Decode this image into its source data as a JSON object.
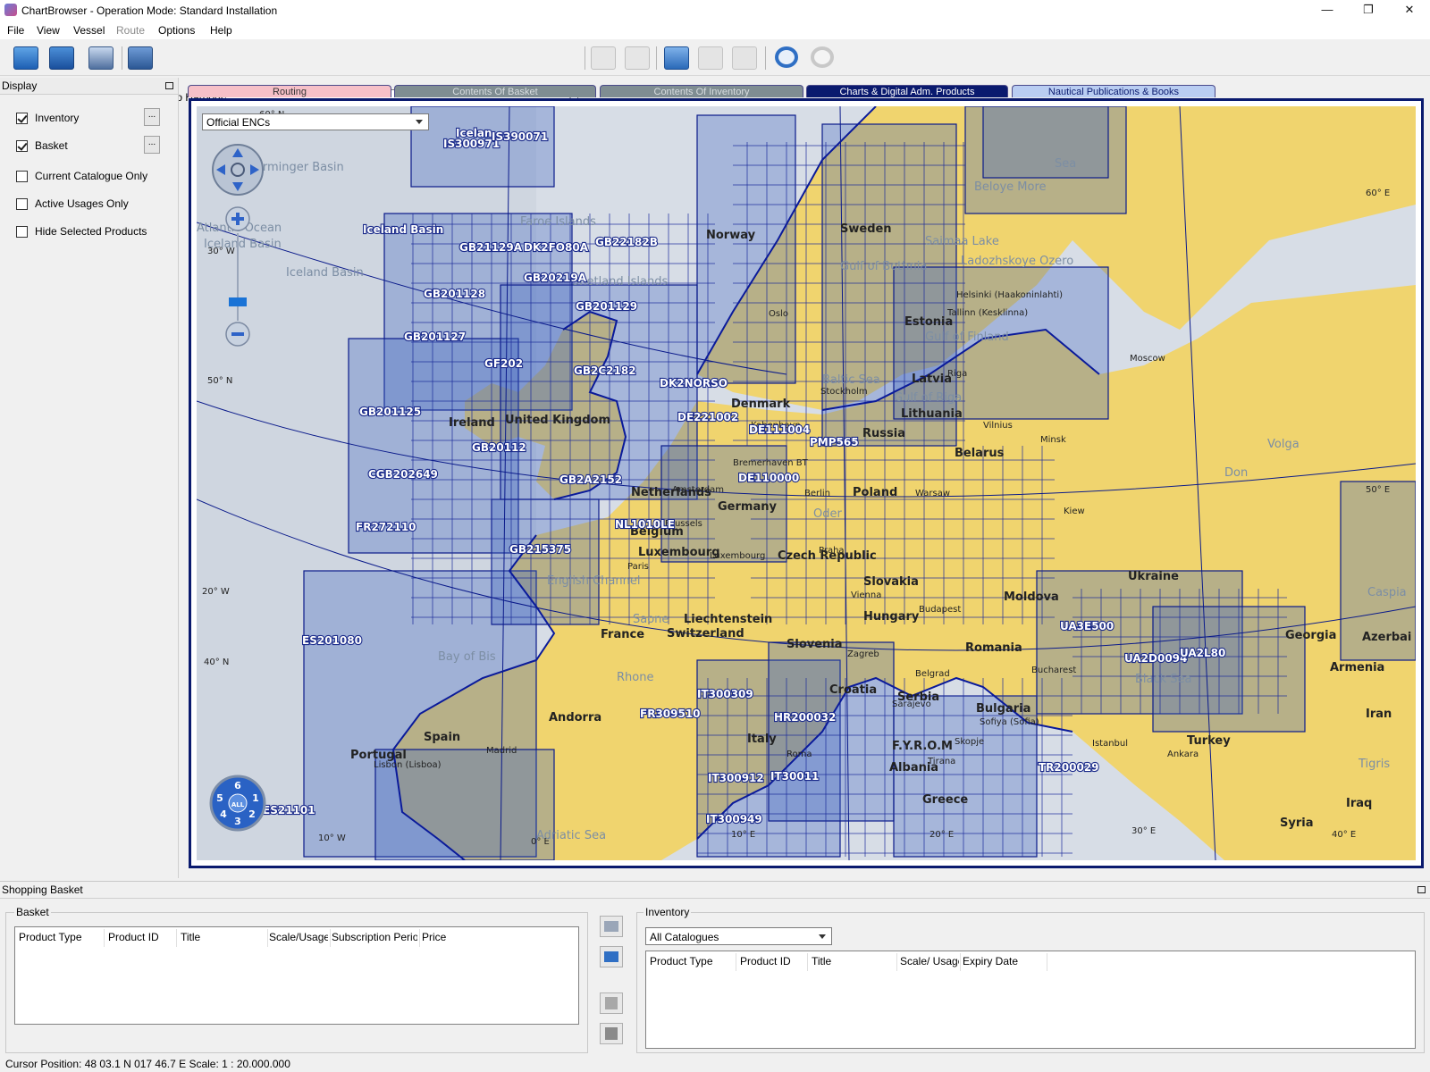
{
  "window": {
    "title": "ChartBrowser - Operation Mode: Standard Installation",
    "controls": {
      "minimize": "—",
      "maximize": "❐",
      "close": "✕"
    }
  },
  "menu": [
    "File",
    "View",
    "Vessel",
    "Route",
    "Options",
    "Help"
  ],
  "toolbar": {
    "goto_label": "Goto Harbour:",
    "goto_value": "",
    "icons": [
      "open-folder-icon",
      "save-icon",
      "vessel-icon",
      "binoculars-icon",
      "zoom-box-icon",
      "zoom-grid-icon",
      "select-pointer-icon",
      "cart-icon",
      "cart-check-icon",
      "undo-icon",
      "redo-icon"
    ]
  },
  "display_panel": {
    "title": "Display",
    "options": [
      {
        "label": "Inventory",
        "checked": true,
        "has_more": true
      },
      {
        "label": "Basket",
        "checked": true,
        "has_more": true
      },
      {
        "label": "Current Catalogue Only",
        "checked": false,
        "has_more": false
      },
      {
        "label": "Active Usages Only",
        "checked": false,
        "has_more": false
      },
      {
        "label": "Hide Selected Products",
        "checked": false,
        "has_more": false
      }
    ],
    "more_label": "..."
  },
  "tabs": [
    {
      "label": "Routing",
      "bg": "#f6c0c8",
      "fg": "#333333"
    },
    {
      "label": "Contents Of Basket",
      "bg": "#7f8d92",
      "fg": "#d8dde0"
    },
    {
      "label": "Contents Of Inventory",
      "bg": "#7f8d92",
      "fg": "#d8dde0"
    },
    {
      "label": "Charts & Digital Adm. Products",
      "bg": "#0a1a6e",
      "fg": "#ffffff",
      "active": true
    },
    {
      "label": "Nautical Publications & Books",
      "bg": "#b9cdf2",
      "fg": "#0a1a6e"
    }
  ],
  "map": {
    "enc_selector": "Official ENCs",
    "colors": {
      "sea": "#d7dde6",
      "land": "#f0d46e",
      "coverage": "#5e7fc6",
      "border": "#0a1a8a"
    },
    "country_labels": [
      "Norway",
      "Sweden",
      "Estonia",
      "Latvia",
      "Lithuania",
      "Russia",
      "Belarus",
      "Denmark",
      "Ireland",
      "United Kingdom",
      "Netherlands",
      "Germany",
      "Poland",
      "Belgium",
      "Luxembourg",
      "Czech Republic",
      "Slovakia",
      "Ukraine",
      "Moldova",
      "Hungary",
      "Liechtenstein",
      "Switzerland",
      "France",
      "Slovenia",
      "Romania",
      "Croatia",
      "Serbia",
      "Bulgaria",
      "Andorra",
      "Spain",
      "Portugal",
      "Italy",
      "F.Y.R.O.M",
      "Albania",
      "Greece",
      "Turkey",
      "Georgia",
      "Azerbai",
      "Armenia",
      "Iran",
      "Iraq",
      "Syria"
    ],
    "cell_labels": [
      "Icelan",
      "IS300971",
      "IS390071",
      "GB21129A",
      "DK2FO80A",
      "GB22182B",
      "GB20219A",
      "GB201128",
      "GB201129",
      "GB201127",
      "GF202",
      "GB2C2182",
      "DK2NORSO",
      "GB201125",
      "GB20112",
      "DE221002",
      "DE111004",
      "PMP565",
      "CGB202649",
      "GB2A2152",
      "DE110000",
      "FR272110",
      "NL1010LE",
      "GB215375",
      "ES201080",
      "FR309510",
      "IT300309",
      "HR200032",
      "IT300912",
      "IT30011",
      "IT300949",
      "UA3E500",
      "UA2D0094",
      "UA2L80",
      "TR200029",
      "ES21101",
      "Iceland Basin"
    ],
    "sea_labels": [
      "Irminger Basin",
      "Atlantic Ocean",
      "Iceland Basin",
      "Iceland Basin",
      "Faroe Islands",
      "Shetland Islands",
      "Sea",
      "Beloye More",
      "Saimaa Lake",
      "Ladozhskoye Ozero",
      "Gulf of Bothnia",
      "Gulf of Finland",
      "Gulf of Riga",
      "English Channel",
      "Bay of Bis",
      "Black Sea",
      "Caspia",
      "Baltic Sea",
      "Adriatic Sea",
      "Oder",
      "Saone",
      "Rhone",
      "Volga",
      "Don",
      "Tigris"
    ],
    "city_labels": [
      "Moscow",
      "Helsinki (Haakoninlahti)",
      "Tallinn (Kesklinna)",
      "Riga",
      "Vilnius",
      "Minsk",
      "Oslo",
      "Bremerhaven BT",
      "Berlin",
      "Warsaw",
      "Kiew",
      "Amsterdam",
      "Brussels",
      "Luxembourg",
      "Paris",
      "Praha",
      "Vienna",
      "Budapest",
      "Zagreb",
      "Belgrad",
      "Sarajevo",
      "Bucharest",
      "Sofiya (Sofia)",
      "Istanbul",
      "Skopje",
      "Tirana",
      "Ankara",
      "Madrid",
      "Lisbon (Lisboa)",
      "Roma",
      "Kobenhavn",
      "Stockholm"
    ],
    "grid_labels": [
      "60° N",
      "50° N",
      "40° N",
      "30° W",
      "20° W",
      "10° W",
      "0° E",
      "10° E",
      "20° E",
      "30° E",
      "40° E",
      "50° E",
      "60° E"
    ],
    "zoom_quick_levels": [
      "6",
      "1",
      "2",
      "3",
      "4",
      "5",
      "ALL"
    ]
  },
  "basket_panel": {
    "title": "Shopping Basket",
    "basket_group": "Basket",
    "basket_columns": [
      "Product Type",
      "Product ID",
      "Title",
      "Scale/Usage",
      "Subscription Period",
      "Price"
    ],
    "inventory_group": "Inventory",
    "inventory_filter": "All Catalogues",
    "inventory_columns": [
      "Product Type",
      "Product ID",
      "Title",
      "Scale/ Usage",
      "Expiry Date"
    ],
    "side_buttons": [
      "move-to-basket-icon",
      "move-to-inventory-icon",
      "help-question-icon",
      "sum-icon"
    ]
  },
  "status": {
    "cursor_position": "Cursor Position:  48 03.1 N  017 46.7 E Scale: 1 : 20.000.000"
  }
}
